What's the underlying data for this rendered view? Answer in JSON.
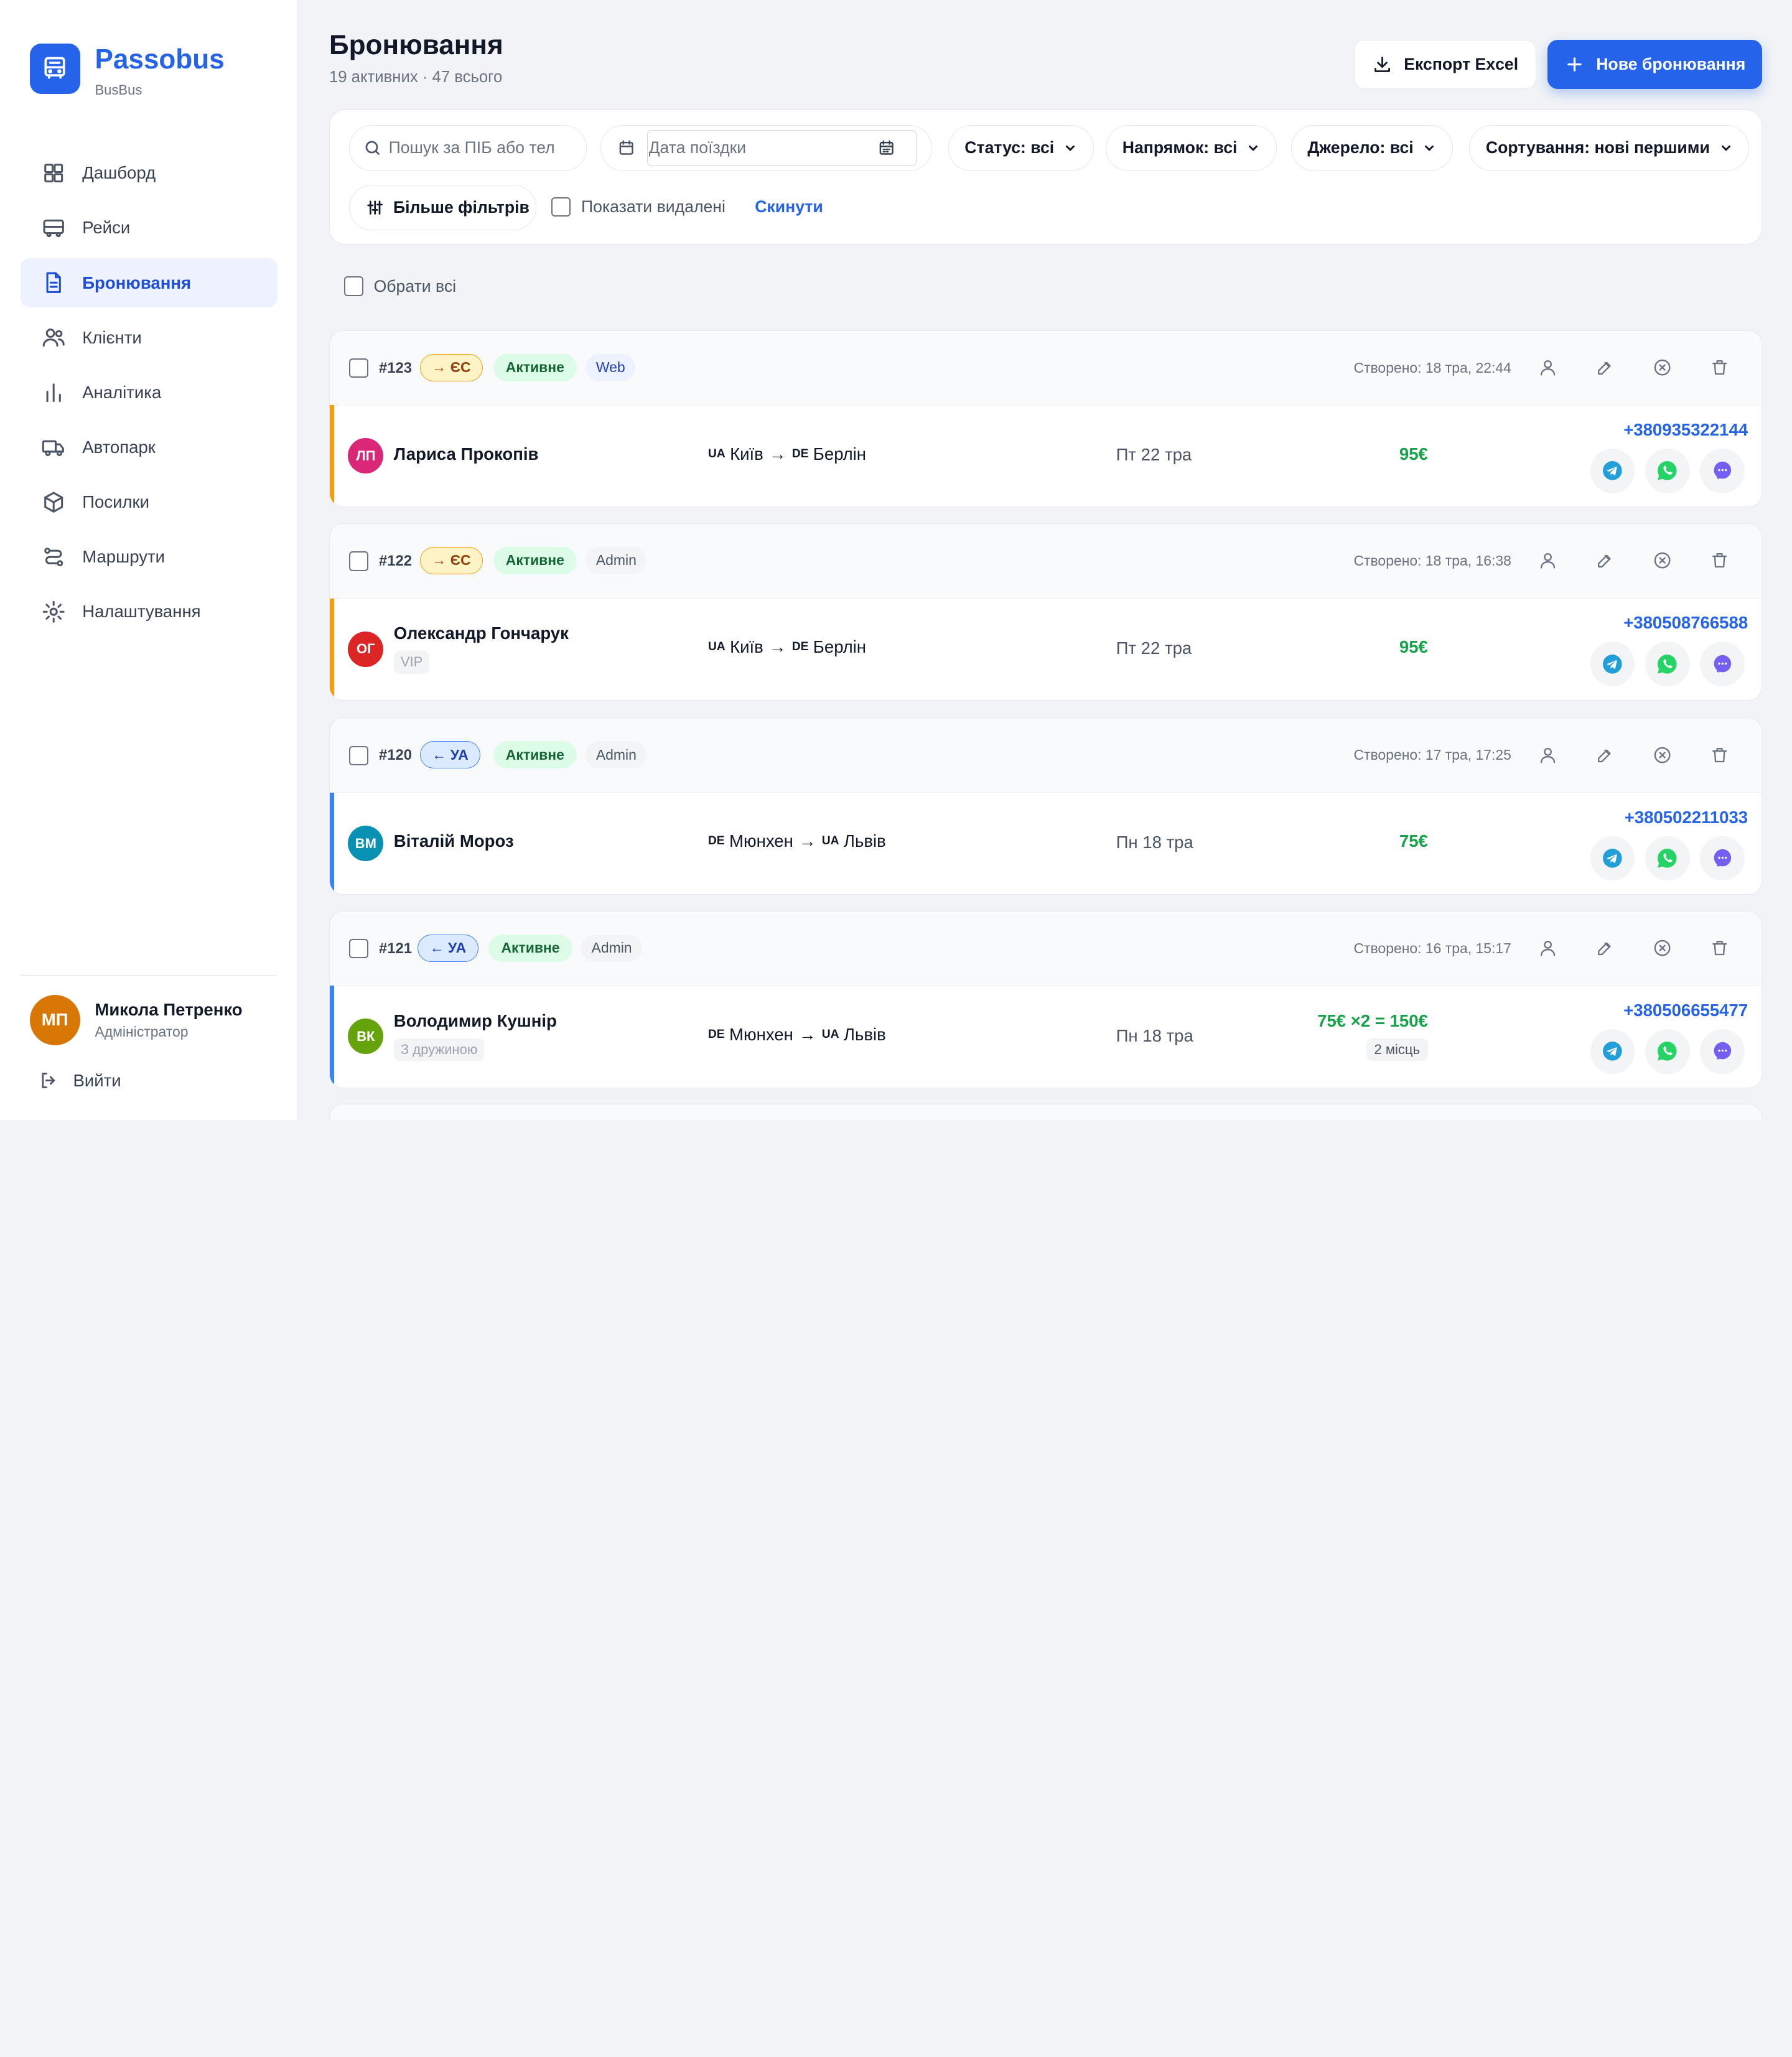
{
  "brand": {
    "name": "Passobus",
    "sub": "BusBus"
  },
  "nav": [
    {
      "label": "Дашборд",
      "icon": "grid-icon"
    },
    {
      "label": "Рейси",
      "icon": "bus-icon"
    },
    {
      "label": "Бронювання",
      "icon": "document-icon",
      "active": true
    },
    {
      "label": "Клієнти",
      "icon": "users-icon"
    },
    {
      "label": "Аналітика",
      "icon": "bar-chart-icon"
    },
    {
      "label": "Автопарк",
      "icon": "truck-icon"
    },
    {
      "label": "Посилки",
      "icon": "package-icon"
    },
    {
      "label": "Маршрути",
      "icon": "route-icon"
    },
    {
      "label": "Налаштування",
      "icon": "gear-icon"
    }
  ],
  "user": {
    "initials": "МП",
    "name": "Микола Петренко",
    "role": "Адміністратор",
    "logout": "Вийти"
  },
  "header": {
    "title": "Бронювання",
    "subtitle": "19 активних · 47 всього",
    "export_label": "Експорт Excel",
    "new_label": "Нове бронювання"
  },
  "filters": {
    "search_placeholder": "Пошук за ПІБ або тел",
    "date_placeholder": "Дата поїздки",
    "status": "Статус: всі",
    "direction": "Напрямок: всі",
    "source": "Джерело: всі",
    "sort": "Сортування: нові першими",
    "more": "Більше фільтрів",
    "show_deleted": "Показати видалені",
    "reset": "Скинути"
  },
  "select_all": "Обрати всі",
  "bookings": [
    {
      "id": "#123",
      "direction": "→ ЄС",
      "dir_type": "eu",
      "status": "Активне",
      "source": "Web",
      "created": "Створено: 18 тра, 22:44",
      "initials": "ЛП",
      "avatar_color": "#db2777",
      "name": "Лариса Прокопів",
      "tag": "",
      "from_code": "UA",
      "from": "Київ",
      "to_code": "DE",
      "to": "Берлін",
      "date": "Пт 22 тра",
      "price": "95€",
      "seats": "",
      "phone": "+380935322144"
    },
    {
      "id": "#122",
      "direction": "→ ЄС",
      "dir_type": "eu",
      "status": "Активне",
      "source": "Admin",
      "created": "Створено: 18 тра, 16:38",
      "initials": "ОГ",
      "avatar_color": "#dc2626",
      "name": "Олександр Гончарук",
      "tag": "VIP",
      "from_code": "UA",
      "from": "Київ",
      "to_code": "DE",
      "to": "Берлін",
      "date": "Пт 22 тра",
      "price": "95€",
      "seats": "",
      "phone": "+380508766588"
    },
    {
      "id": "#120",
      "direction": "← УА",
      "dir_type": "ua",
      "status": "Активне",
      "source": "Admin",
      "created": "Створено: 17 тра, 17:25",
      "initials": "ВМ",
      "avatar_color": "#0891b2",
      "name": "Віталій Мороз",
      "tag": "",
      "from_code": "DE",
      "from": "Мюнхен",
      "to_code": "UA",
      "to": "Львів",
      "date": "Пн 18 тра",
      "price": "75€",
      "seats": "",
      "phone": "+380502211033"
    },
    {
      "id": "#121",
      "direction": "← УА",
      "dir_type": "ua",
      "status": "Активне",
      "source": "Admin",
      "created": "Створено: 16 тра, 15:17",
      "initials": "ВК",
      "avatar_color": "#65a30d",
      "name": "Володимир Кушнір",
      "tag": "З дружиною",
      "from_code": "DE",
      "from": "Мюнхен",
      "to_code": "UA",
      "to": "Львів",
      "date": "Пн 18 тра",
      "price": "75€ ×2 = 150€",
      "seats": "2 місць",
      "phone": "+380506655477"
    }
  ],
  "colors": {
    "accent": "#2563eb",
    "eu_bar": "#f59e0b",
    "ua_bar": "#3b82f6",
    "price": "#16a34a"
  }
}
